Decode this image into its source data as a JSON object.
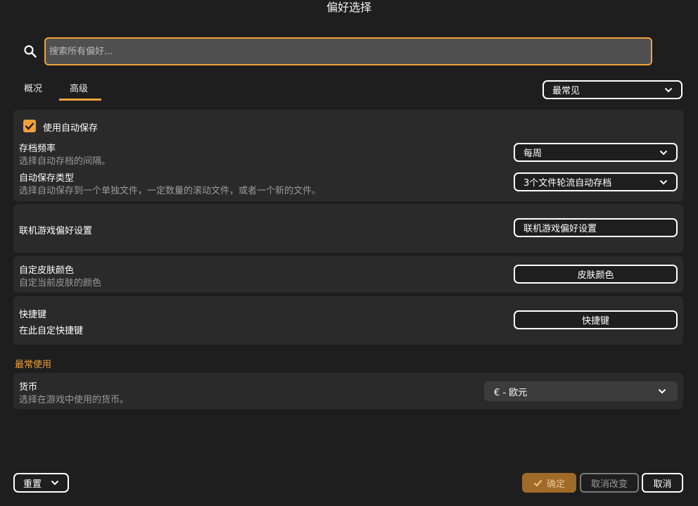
{
  "window": {
    "title": "偏好选择"
  },
  "search": {
    "placeholder": "搜索所有偏好..."
  },
  "tabs": [
    {
      "label": "概况",
      "active": false
    },
    {
      "label": "高级",
      "active": true
    }
  ],
  "filter_dropdown": {
    "value": "最常见"
  },
  "autosave": {
    "checkbox_label": "使用自动保存",
    "checked": true,
    "frequency": {
      "title": "存档频率",
      "description": "选择自动存档的间隔。",
      "value": "每周"
    },
    "type": {
      "title": "自动保存类型",
      "description": "选择自动保存到一个单独文件，一定数量的滚动文件，或者一个新的文件。",
      "value": "3个文件轮流自动存档"
    }
  },
  "multiplayer": {
    "title": "联机游戏偏好设置",
    "button_label": "联机游戏偏好设置"
  },
  "skin": {
    "title": "自定皮肤颜色",
    "description": "自定当前皮肤的颜色",
    "button_label": "皮肤颜色"
  },
  "hotkeys": {
    "title": "快捷键",
    "description": "在此自定快捷键",
    "button_label": "快捷键"
  },
  "most_used": {
    "heading": "最常使用",
    "currency": {
      "title": "货币",
      "description": "选择在游戏中使用的货币。",
      "value": "€ - 欧元"
    }
  },
  "footer": {
    "reset_label": "重置",
    "ok_label": "确定",
    "revert_label": "取消改变",
    "cancel_label": "取消"
  },
  "colors": {
    "accent": "#f0a13a",
    "background": "#1e1e1e",
    "panel": "#2a2a2a"
  }
}
